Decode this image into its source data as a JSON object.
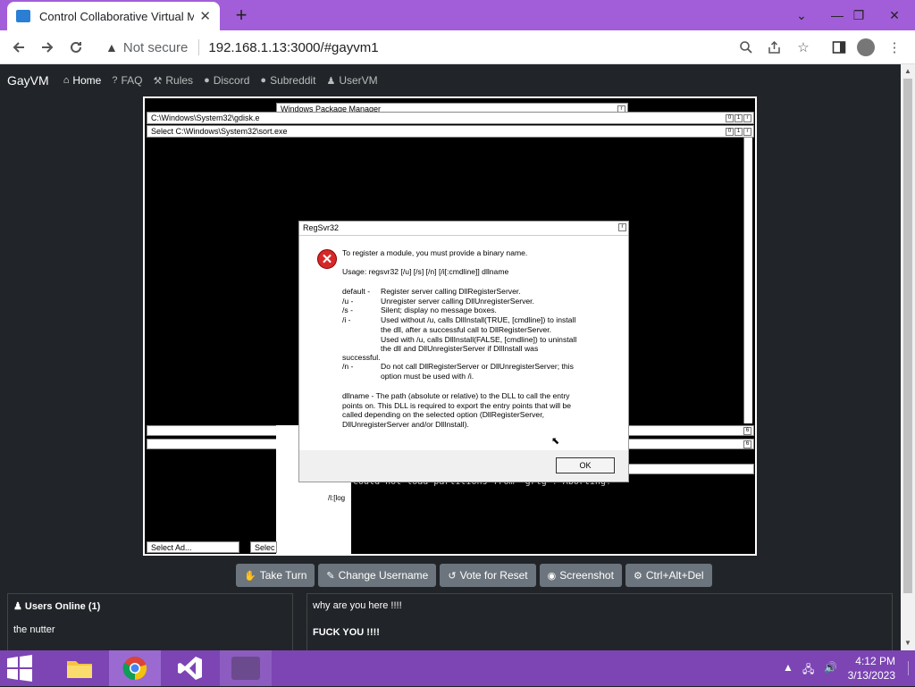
{
  "browser": {
    "tab_title": "Control Collaborative Virtual Ma",
    "tab_close": "✕",
    "new_tab": "+",
    "not_secure": "Not secure",
    "url": "192.168.1.13:3000/#gayvm1",
    "window_controls": {
      "minimize": "⌄",
      "restore_down": "—",
      "maximize": "❐",
      "close": "✕"
    }
  },
  "nav": {
    "brand": "GayVM",
    "links": [
      "Home",
      "FAQ",
      "Rules",
      "Discord",
      "Subreddit",
      "UserVM"
    ]
  },
  "vm": {
    "win_package_manager": "Windows Package Manager",
    "cmd1_title": "C:\\Windows\\System32\\gdisk.e",
    "cmd2_title": "Select C:\\Windows\\System32\\sort.exe",
    "grub_error": "could not load partitions from `grlg`! Aborting!",
    "log_frag": "/l:[log",
    "task1": "Select Ad...",
    "task2": "Selec",
    "dialog": {
      "title": "RegSvr32",
      "line1": "To register a module, you must provide a binary name.",
      "usage": "Usage: regsvr32 [/u] [/s] [/n] [/i[:cmdline]] dllname",
      "options": [
        [
          "default -",
          "Register server calling DllRegisterServer."
        ],
        [
          "/u -",
          "Unregister server calling DllUnregisterServer."
        ],
        [
          "/s -",
          "Silent; display no message boxes."
        ],
        [
          "/i -",
          "Used without /u, calls DllInstall(TRUE, [cmdline]) to install"
        ],
        [
          "",
          "the dll, after a successful call to DllRegisterServer."
        ],
        [
          "",
          "Used with /u, calls DllInstall(FALSE, [cmdline]) to uninstall"
        ],
        [
          "",
          "the dll and DllUnregisterServer if DllInstall was"
        ]
      ],
      "successful": "successful.",
      "n_opt": [
        "/n -",
        "Do not call DllRegisterServer or DllUnregisterServer; this"
      ],
      "n_opt2": "option must be used with /i.",
      "dllname_lines": [
        "dllname - The path (absolute or relative) to the DLL to call the entry",
        "points on. This DLL is required to export the entry points that will be",
        "called depending on the selected option (DllRegisterServer,",
        "DllUnregisterServer and/or DllInstall)."
      ],
      "ok": "OK"
    }
  },
  "buttons": [
    "Take Turn",
    "Change Username",
    "Vote for Reset",
    "Screenshot",
    "Ctrl+Alt+Del"
  ],
  "users": {
    "header": "Users Online (1)",
    "list": [
      "the nutter"
    ]
  },
  "chat": {
    "messages": [
      "why are you here !!!!",
      "FUCK YOU !!!!"
    ]
  },
  "taskbar": {
    "time": "4:12 PM",
    "date": "3/13/2023"
  },
  "colors": {
    "titlebar": "#a25ed8",
    "page_bg": "#212529",
    "taskbar": "#7c45b3",
    "button": "#6c757d"
  }
}
